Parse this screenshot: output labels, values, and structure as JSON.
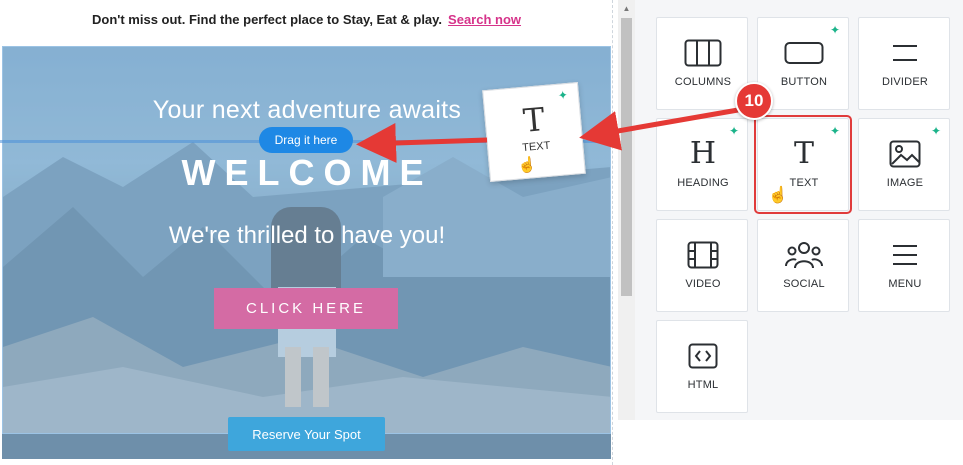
{
  "preheader": {
    "message": "Don't miss out. Find the perfect place to Stay, Eat & play.",
    "link": "Search now"
  },
  "hero": {
    "title": "Your next adventure awaits",
    "drag_hint": "Drag it here",
    "welcome": "WELCOME",
    "subtitle": "We're thrilled to have you!",
    "cta": "CLICK HERE",
    "reserve": "Reserve Your Spot"
  },
  "drag_card": {
    "label": "TEXT",
    "glyph": "T",
    "icon": "text-icon"
  },
  "step": "10",
  "blocks": [
    {
      "label": "COLUMNS",
      "icon": "columns-icon"
    },
    {
      "label": "BUTTON",
      "icon": "button-icon",
      "new": true
    },
    {
      "label": "DIVIDER",
      "icon": "divider-icon"
    },
    {
      "label": "HEADING",
      "icon": "heading-icon",
      "glyph": "H",
      "new": true
    },
    {
      "label": "TEXT",
      "icon": "text-icon",
      "glyph": "T",
      "new": true,
      "highlighted": true
    },
    {
      "label": "IMAGE",
      "icon": "image-icon",
      "new": true
    },
    {
      "label": "VIDEO",
      "icon": "video-icon"
    },
    {
      "label": "SOCIAL",
      "icon": "social-icon"
    },
    {
      "label": "MENU",
      "icon": "menu-icon"
    },
    {
      "label": "HTML",
      "icon": "html-icon"
    }
  ],
  "colors": {
    "accent": "#1e88e5",
    "cta": "#d46ba4",
    "reserve": "#3ea6dc",
    "annotation": "#e53935",
    "new_badge": "#1bb38a"
  }
}
